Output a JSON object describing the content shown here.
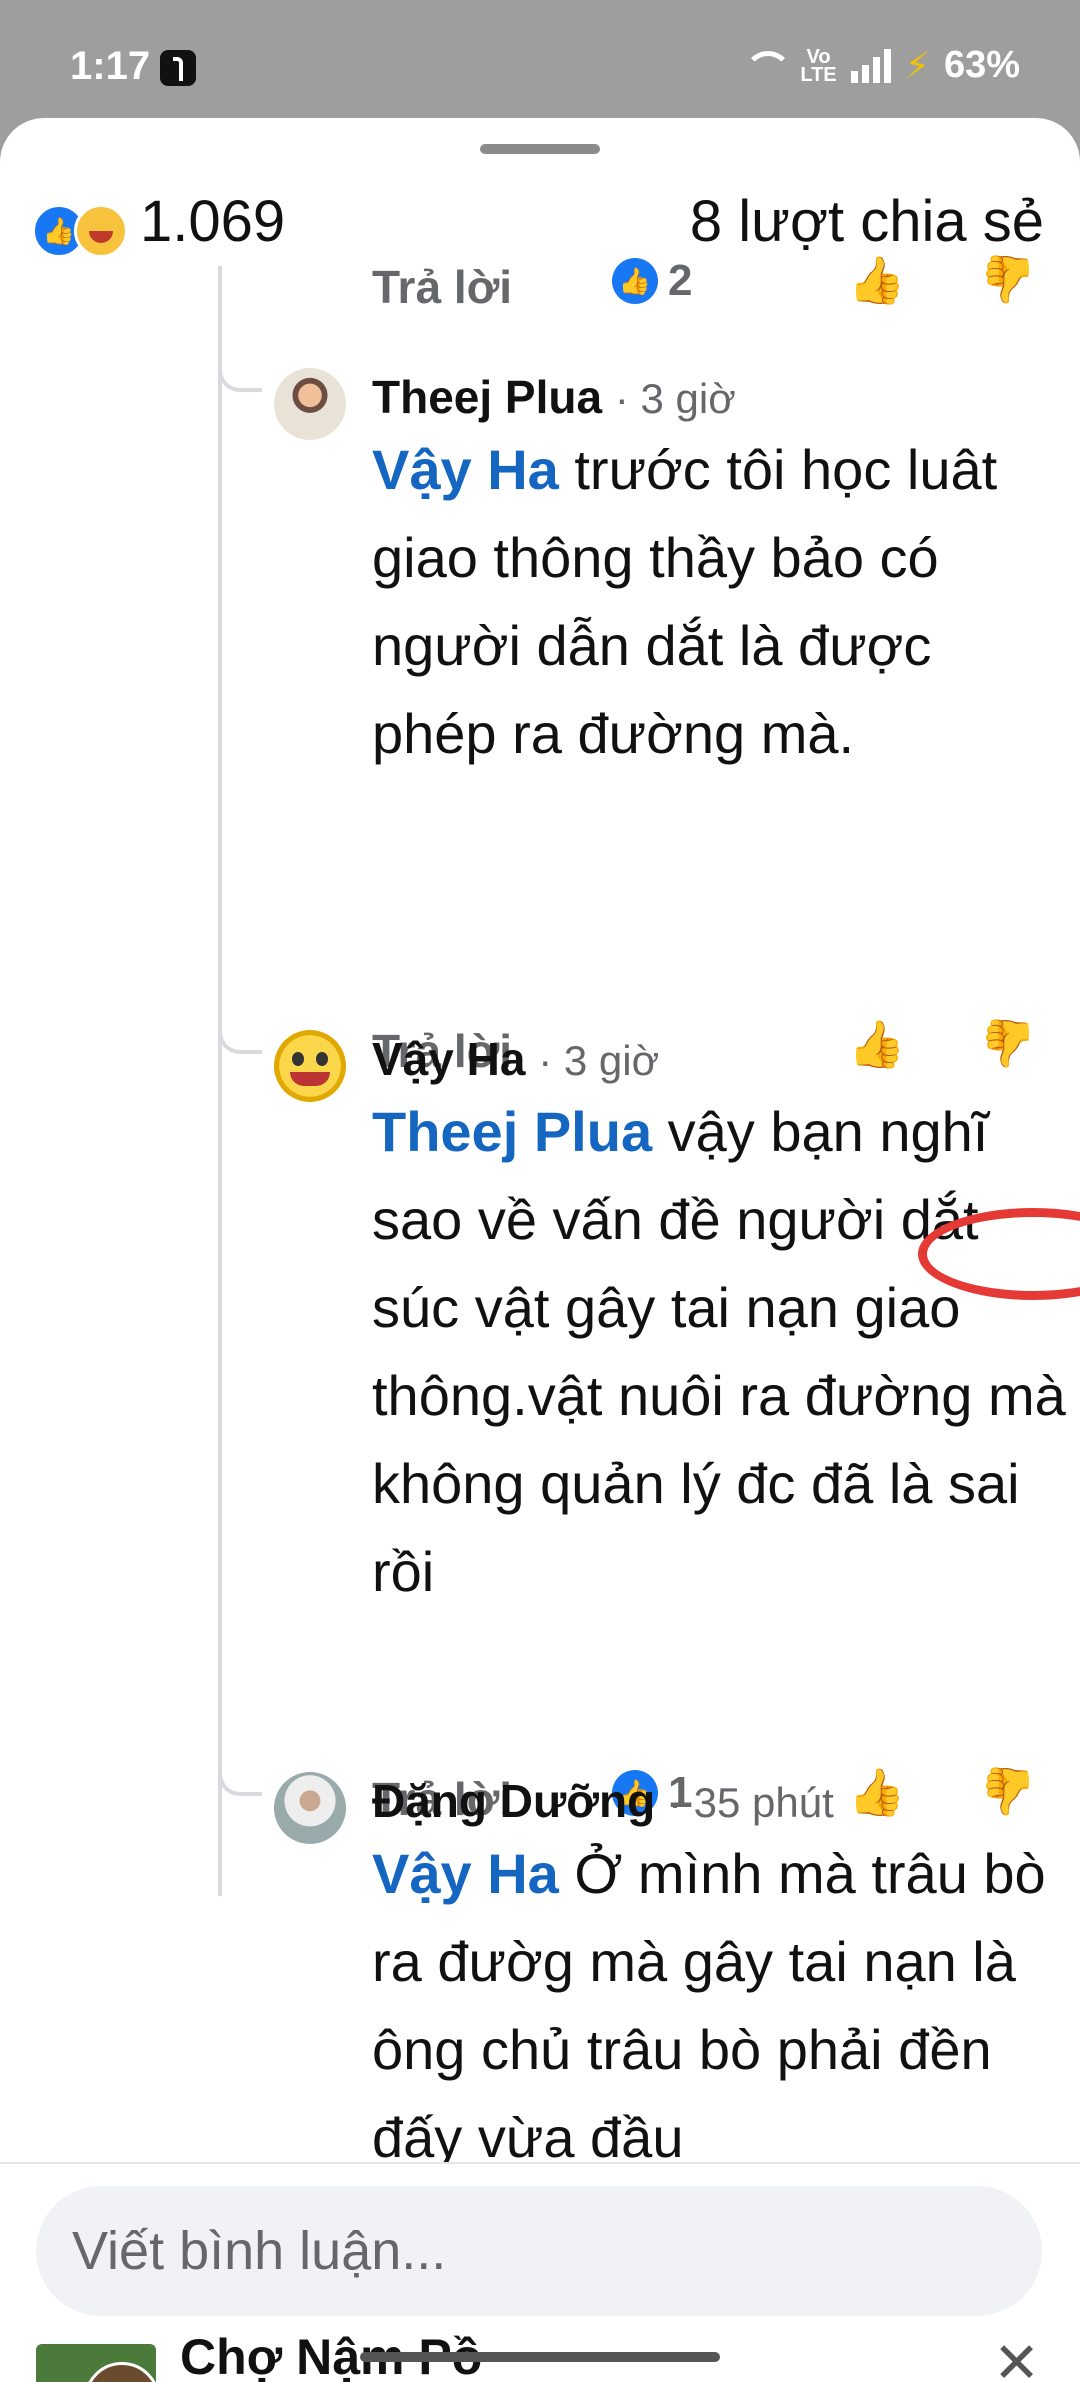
{
  "status_bar": {
    "time": "1:17",
    "network": "Vo LTE",
    "battery": "63%"
  },
  "header": {
    "reaction_count": "1.069",
    "share_count": "8 lượt chia sẻ"
  },
  "top_action": {
    "reply_label": "Trả lời",
    "reaction_count": "2"
  },
  "comments": [
    {
      "author": "Theej Plua",
      "time": "· 3 giờ",
      "mention": "Vậy Ha",
      "text": " trước tôi học luât giao thông thầy bảo có người dẫn dắt là được phép ra đường mà.",
      "reply_label": "Trả lời"
    },
    {
      "author": "Vậy Ha",
      "time": "· 3 giờ",
      "mention": "Theej Plua",
      "text": " vậy bạn nghĩ sao về vấn đề người dắt súc vật gây tai nạn giao thông.vật nuôi ra đường  mà không quản lý đc đã là sai rồi",
      "reply_label": "Trả lời",
      "reaction_count": "1"
    },
    {
      "author": "Đặng Dưỡng",
      "time": "· 35 phút",
      "mention": "Vậy Ha",
      "text": " Ở mình mà trâu bò ra đườg mà gây tai nạn là ông chủ trâu bò phải đền đấy vừa đầu"
    }
  ],
  "composer": {
    "placeholder": "Viết bình luận..."
  },
  "peek": {
    "title": "Chợ Nậm Pồ"
  },
  "colors": {
    "accent": "#1877f2",
    "mention": "#1566c0",
    "annotation_circle": "#e53935"
  }
}
